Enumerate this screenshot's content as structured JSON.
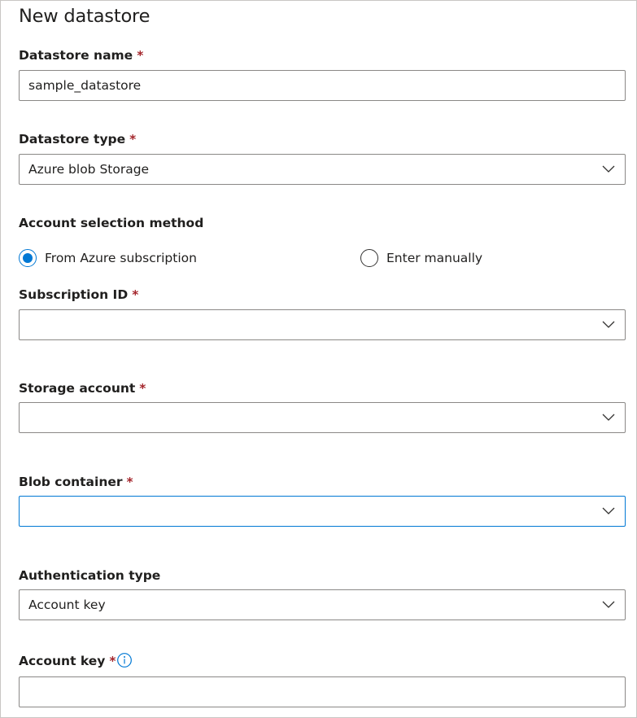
{
  "page": {
    "title": "New datastore"
  },
  "form": {
    "datastore_name": {
      "label": "Datastore name",
      "required_mark": "*",
      "value": "sample_datastore"
    },
    "datastore_type": {
      "label": "Datastore type",
      "required_mark": "*",
      "value": "Azure blob Storage"
    },
    "account_selection": {
      "label": "Account selection method",
      "options": [
        {
          "label": "From Azure subscription",
          "selected": true
        },
        {
          "label": "Enter manually",
          "selected": false
        }
      ]
    },
    "subscription_id": {
      "label": "Subscription ID",
      "required_mark": "*",
      "value": ""
    },
    "storage_account": {
      "label": "Storage account",
      "required_mark": "*",
      "value": ""
    },
    "blob_container": {
      "label": "Blob container",
      "required_mark": "*",
      "value": ""
    },
    "authentication_type": {
      "label": "Authentication type",
      "value": "Account key"
    },
    "account_key": {
      "label": "Account key",
      "required_mark": "*",
      "value": "",
      "info_icon": "info-icon"
    }
  },
  "colors": {
    "accent": "#0078d4",
    "required": "#a4262c",
    "border": "#8a8886"
  }
}
